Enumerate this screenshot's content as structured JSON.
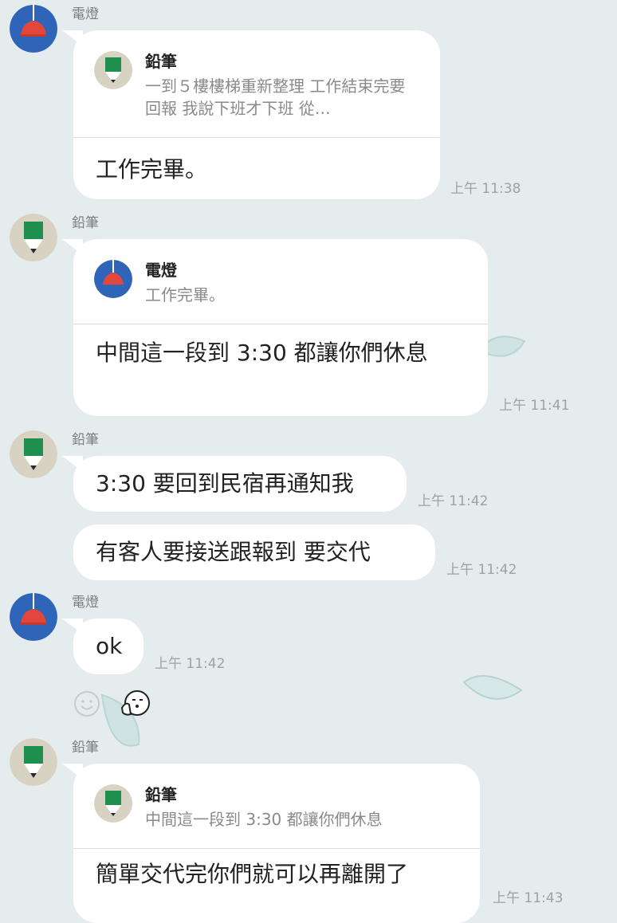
{
  "colors": {
    "background": "#e5eced",
    "bubble": "#ffffff",
    "lamp_avatar_bg": "#2f65b9",
    "lamp_shade": "#e2473b",
    "pencil_avatar_bg": "#d8d2c2",
    "pencil_green": "#1f8f4f"
  },
  "messages": [
    {
      "sender": "電燈",
      "avatar_icon": "lamp-avatar-icon",
      "reply_to": {
        "name": "鉛筆",
        "text": "一到５樓樓梯重新整理 工作結束完要回報 我說下班才下班 從…",
        "avatar_icon": "pencil-avatar-icon"
      },
      "text": "工作完畢。",
      "time": "上午 11:38"
    },
    {
      "sender": "鉛筆",
      "avatar_icon": "pencil-avatar-icon",
      "reply_to": {
        "name": "電燈",
        "text": "工作完畢。",
        "avatar_icon": "lamp-avatar-icon"
      },
      "text": "中間這一段到 3:30 都讓你們休息",
      "time": "上午 11:41"
    },
    {
      "sender": "鉛筆",
      "avatar_icon": "pencil-avatar-icon",
      "text": "3:30 要回到民宿再通知我",
      "time": "上午 11:42"
    },
    {
      "text": "有客人要接送跟報到 要交代",
      "time": "上午 11:42"
    },
    {
      "sender": "電燈",
      "avatar_icon": "lamp-avatar-icon",
      "text": "ok",
      "time": "上午 11:42"
    },
    {
      "sender": "鉛筆",
      "avatar_icon": "pencil-avatar-icon",
      "reply_to": {
        "name": "鉛筆",
        "text": "中間這一段到 3:30 都讓你們休息",
        "avatar_icon": "pencil-avatar-icon"
      },
      "text": "簡單交代完你們就可以再離開了",
      "time": "上午 11:43"
    }
  ],
  "reactions": {
    "add_icon": "smiley-add-icon",
    "sticker_icon": "thumbs-up-face-icon"
  }
}
